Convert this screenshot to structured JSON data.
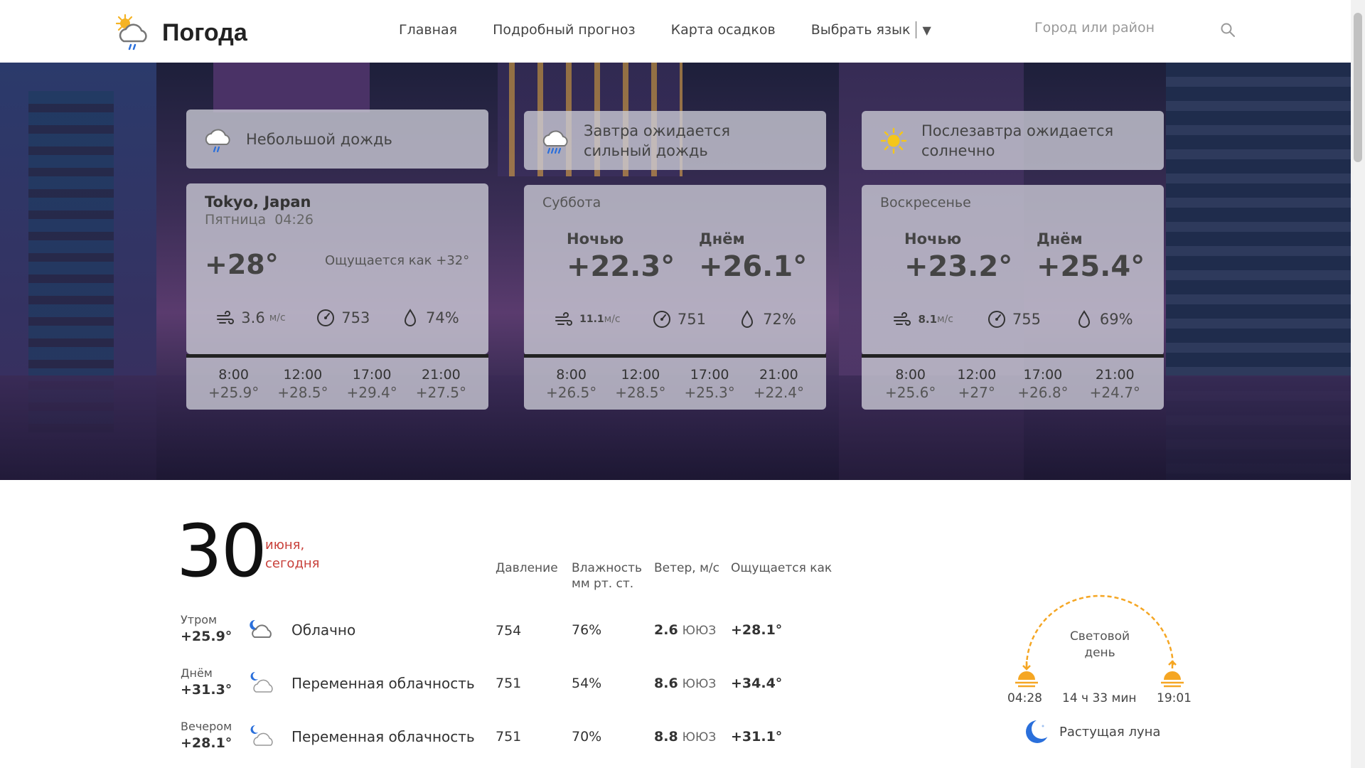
{
  "header": {
    "logo_text": "Погода",
    "nav": [
      "Главная",
      "Подробный прогноз",
      "Карта осадков",
      "Выбрать язык"
    ],
    "search_placeholder": "Город или район"
  },
  "alerts": [
    {
      "text": "Небольшой дождь",
      "icon": "light-rain-cloud-icon"
    },
    {
      "text": "Завтра ожидается сильный дождь",
      "icon": "heavy-rain-cloud-icon"
    },
    {
      "text": "Послезавтра ожидается солнечно",
      "icon": "sun-icon"
    }
  ],
  "today": {
    "city": "Tokyo, Japan",
    "weekday": "Пятница",
    "time": "04:26",
    "temp": "+28°",
    "feels": "Ощущается как +32°",
    "wind": "3.6",
    "wind_unit": "м/с",
    "pressure": "753",
    "humidity": "74%",
    "hours": [
      {
        "t": "8:00",
        "v": "+25.9°"
      },
      {
        "t": "12:00",
        "v": "+28.5°"
      },
      {
        "t": "17:00",
        "v": "+29.4°"
      },
      {
        "t": "21:00",
        "v": "+27.5°"
      }
    ]
  },
  "saturday": {
    "name": "Суббота",
    "night_label": "Ночью",
    "night": "+22.3°",
    "day_label": "Днём",
    "day": "+26.1°",
    "wind": "11.1",
    "wind_unit": "м/с",
    "pressure": "751",
    "humidity": "72%",
    "hours": [
      {
        "t": "8:00",
        "v": "+26.5°"
      },
      {
        "t": "12:00",
        "v": "+28.5°"
      },
      {
        "t": "17:00",
        "v": "+25.3°"
      },
      {
        "t": "21:00",
        "v": "+22.4°"
      }
    ]
  },
  "sunday": {
    "name": "Воскресенье",
    "night_label": "Ночью",
    "night": "+23.2°",
    "day_label": "Днём",
    "day": "+25.4°",
    "wind": "8.1",
    "wind_unit": "м/с",
    "pressure": "755",
    "humidity": "69%",
    "hours": [
      {
        "t": "8:00",
        "v": "+25.6°"
      },
      {
        "t": "12:00",
        "v": "+27°"
      },
      {
        "t": "17:00",
        "v": "+26.8°"
      },
      {
        "t": "21:00",
        "v": "+24.7°"
      }
    ]
  },
  "detail": {
    "day_number": "30",
    "month_line1": "июня,",
    "month_line2": "сегодня",
    "columns": {
      "pressure": "Давление",
      "humidity": "Влажность",
      "humidity_unit": "мм рт. ст.",
      "wind": "Ветер, м/с",
      "feels": "Ощущается как"
    },
    "rows": [
      {
        "when": "Утром",
        "temp": "+25.9°",
        "icon": "night-cloudy-icon",
        "desc": "Облачно",
        "pressure": "754",
        "humidity": "76%",
        "wind": "2.6",
        "dir": "ЮЮЗ",
        "feels": "+28.1°"
      },
      {
        "when": "Днём",
        "temp": "+31.3°",
        "icon": "night-partly-cloudy-icon",
        "desc": "Переменная облачность",
        "pressure": "751",
        "humidity": "54%",
        "wind": "8.6",
        "dir": "ЮЮЗ",
        "feels": "+34.4°"
      },
      {
        "when": "Вечером",
        "temp": "+28.1°",
        "icon": "night-partly-cloudy-icon",
        "desc": "Переменная облачность",
        "pressure": "751",
        "humidity": "70%",
        "wind": "8.8",
        "dir": "ЮЮЗ",
        "feels": "+31.1°"
      }
    ]
  },
  "sun": {
    "label_line1": "Световой",
    "label_line2": "день",
    "sunrise": "04:28",
    "daylength": "14 ч 33 мин",
    "sunset": "19:01"
  },
  "moon": {
    "phase": "Растущая луна"
  },
  "colors": {
    "accent_red": "#c8403a",
    "sun_orange": "#f5a623",
    "moon_blue": "#2a6fdb"
  }
}
